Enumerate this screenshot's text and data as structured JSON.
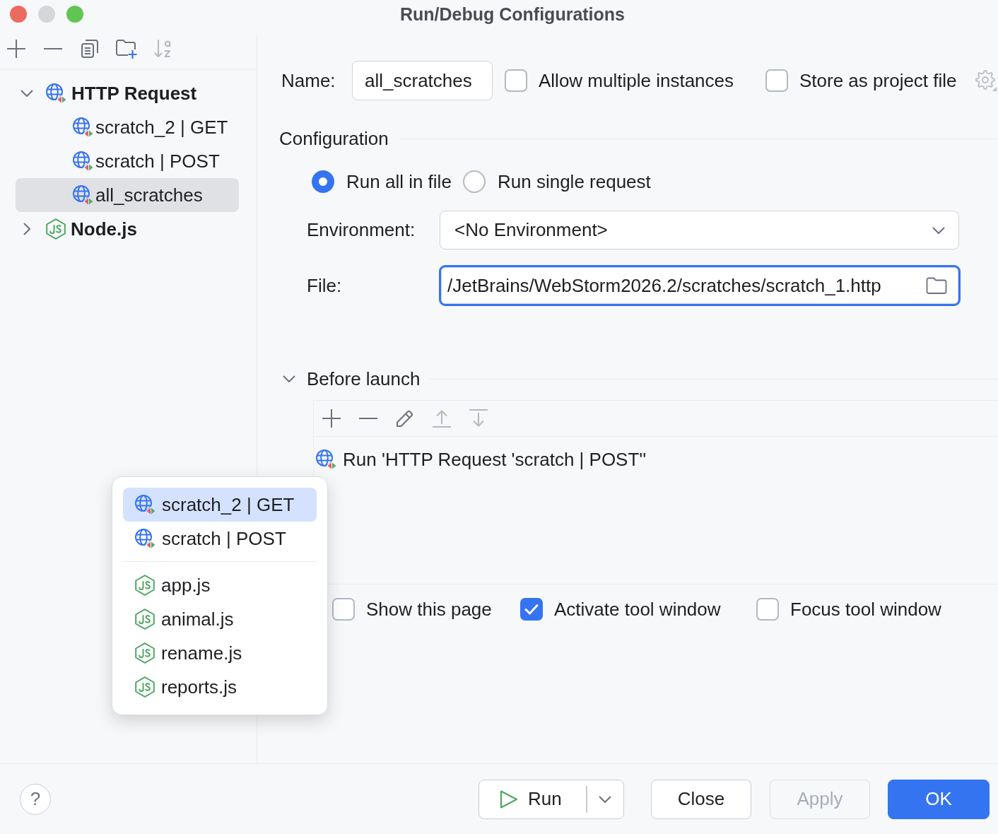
{
  "window": {
    "title": "Run/Debug Configurations",
    "controls": [
      {
        "kind": "close",
        "disabled": false
      },
      {
        "kind": "minimize",
        "disabled": true
      },
      {
        "kind": "zoom",
        "disabled": false
      }
    ]
  },
  "sidebar": {
    "toolbar": [
      {
        "kind": "add",
        "disabled": false
      },
      {
        "kind": "remove",
        "disabled": false
      },
      {
        "kind": "copy",
        "disabled": false
      },
      {
        "kind": "folder",
        "disabled": false
      },
      {
        "kind": "sort",
        "disabled": true
      }
    ],
    "tree": [
      {
        "kind": "http",
        "label": "HTTP Request",
        "expanded": true,
        "selected": false,
        "children": [
          {
            "kind": "http",
            "label": "scratch_2 | GET",
            "selected": false
          },
          {
            "kind": "http",
            "label": "scratch | POST",
            "selected": false
          },
          {
            "kind": "http",
            "label": "all_scratches",
            "selected": true
          }
        ]
      },
      {
        "kind": "node",
        "label": "Node.js",
        "expanded": false,
        "selected": false
      }
    ]
  },
  "name": {
    "label": "Name:",
    "value": "all_scratches"
  },
  "header_options": [
    {
      "label": "Allow multiple instances",
      "checked": false
    },
    {
      "label": "Store as project file",
      "checked": false
    }
  ],
  "configuration": {
    "title": "Configuration",
    "run_modes": [
      {
        "label": "Run all in file",
        "selected": true
      },
      {
        "label": "Run single request",
        "selected": false
      }
    ],
    "environment": {
      "label": "Environment:",
      "value": "<No Environment>"
    },
    "file": {
      "label": "File:",
      "value": "/JetBrains/WebStorm2026.2/scratches/scratch_1.http",
      "focused": true
    }
  },
  "before_launch": {
    "title": "Before launch",
    "expanded": true,
    "toolbar": [
      {
        "kind": "add",
        "disabled": false
      },
      {
        "kind": "remove",
        "disabled": false
      },
      {
        "kind": "edit",
        "disabled": false
      },
      {
        "kind": "up",
        "disabled": true
      },
      {
        "kind": "down",
        "disabled": true
      }
    ],
    "tasks": [
      {
        "kind": "http",
        "label": "Run 'HTTP Request 'scratch | POST''"
      }
    ]
  },
  "launch_options": [
    {
      "label": "Show this page",
      "checked": false
    },
    {
      "label": "Activate tool window",
      "checked": true
    },
    {
      "label": "Focus tool window",
      "checked": false
    }
  ],
  "popup": {
    "groups": [
      {
        "items": [
          {
            "kind": "http",
            "label": "scratch_2 | GET",
            "selected": true
          },
          {
            "kind": "http",
            "label": "scratch | POST",
            "selected": false
          }
        ]
      },
      {
        "items": [
          {
            "kind": "node",
            "label": "app.js",
            "selected": false
          },
          {
            "kind": "node",
            "label": "animal.js",
            "selected": false
          },
          {
            "kind": "node",
            "label": "rename.js",
            "selected": false
          },
          {
            "kind": "node",
            "label": "reports.js",
            "selected": false
          }
        ]
      }
    ]
  },
  "footer": {
    "help": "?",
    "buttons": [
      {
        "kind": "split",
        "label": "Run",
        "disabled": false
      },
      {
        "kind": "default",
        "label": "Close",
        "disabled": false
      },
      {
        "kind": "default",
        "label": "Apply",
        "disabled": true
      },
      {
        "kind": "primary",
        "label": "OK",
        "disabled": false
      }
    ]
  }
}
